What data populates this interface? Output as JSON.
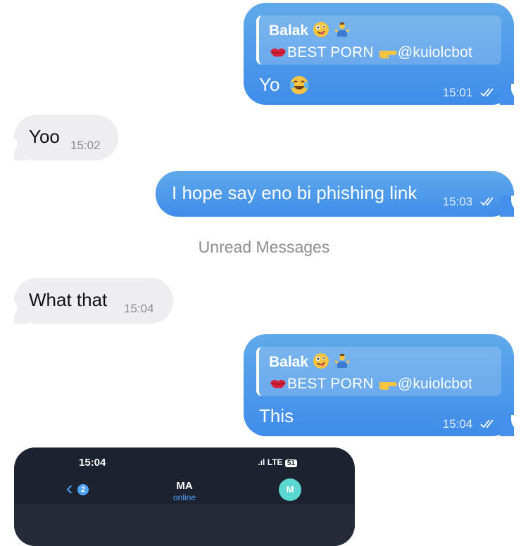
{
  "messages": [
    {
      "direction": "out",
      "reply": {
        "name": "Balak",
        "text": "BEST PORN → @kuiolcbot"
      },
      "text": "Yo",
      "time": "15:01"
    },
    {
      "direction": "in",
      "text": "Yoo",
      "time": "15:02"
    },
    {
      "direction": "out",
      "text": "I hope say eno bi phishing link",
      "time": "15:03"
    },
    {
      "direction": "in",
      "text": "What that",
      "time": "15:04"
    },
    {
      "direction": "out",
      "reply": {
        "name": "Balak",
        "text": "BEST PORN → @kuiolcbot"
      },
      "text": "This",
      "time": "15:04"
    }
  ],
  "reply_display": {
    "name": "Balak",
    "prefix": "BEST P",
    "o": "O",
    "rn": "RN",
    "handle": "@kuiolcbot"
  },
  "unread_label": "Unread Messages",
  "screenshot": {
    "time": "15:04",
    "status": "LTE",
    "battery": "51",
    "back_badge": "2",
    "contact_name": "MA",
    "contact_status": "online",
    "avatar_letter": "M"
  },
  "colors": {
    "outgoing": "#4590ea",
    "incoming": "#eeeef0",
    "accent": "#4ea2ff"
  }
}
